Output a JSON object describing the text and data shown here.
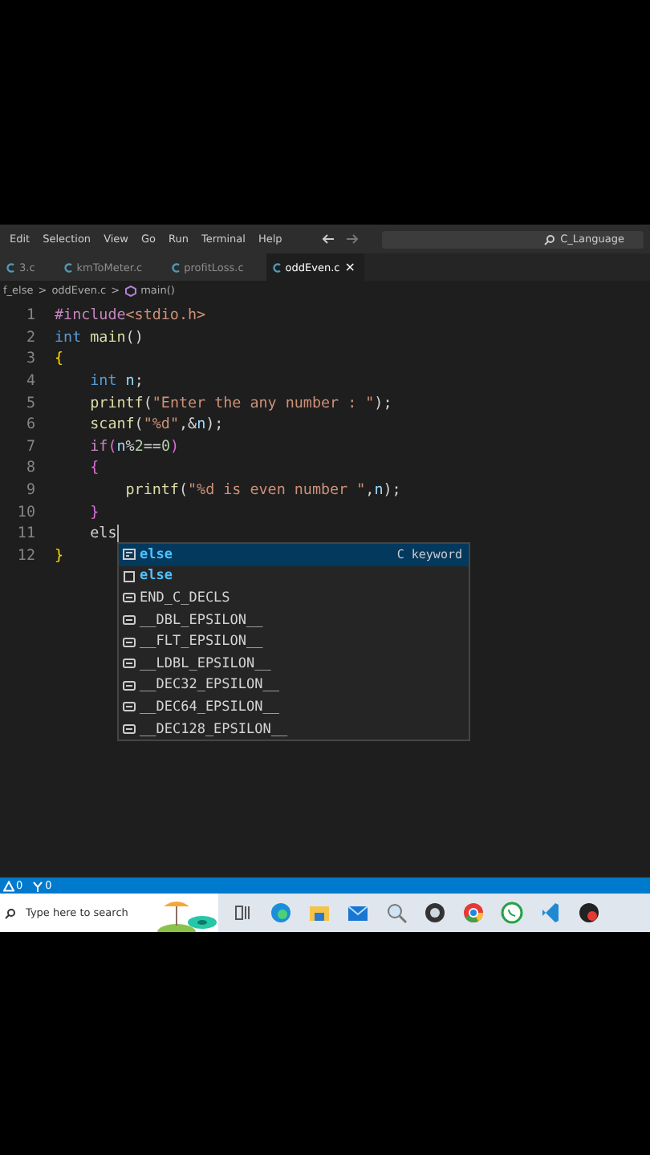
{
  "menu": [
    "Edit",
    "Selection",
    "View",
    "Go",
    "Run",
    "Terminal",
    "Help"
  ],
  "search": {
    "value": "C_Language"
  },
  "tabs": [
    {
      "label": "3.c",
      "selected": false
    },
    {
      "label": "kmToMeter.c",
      "selected": false
    },
    {
      "label": "profitLoss.c",
      "selected": false
    },
    {
      "label": "oddEven.c",
      "selected": true,
      "close": "×"
    }
  ],
  "breadcrumb": [
    "f_else",
    ">",
    "oddEven.c",
    ">",
    "main()"
  ],
  "code": [
    {
      "number": "1",
      "tokens": [
        {
          "text": "#include",
          "kind": "directive"
        },
        {
          "text": "<stdio.h>",
          "kind": "string"
        }
      ]
    },
    {
      "number": "2",
      "tokens": [
        {
          "text": "int",
          "kind": "keyword"
        },
        {
          "text": " main",
          "kind": "function"
        },
        {
          "text": "()",
          "kind": "plain"
        }
      ]
    },
    {
      "number": "3",
      "tokens": [
        {
          "text": "{",
          "kind": "brace"
        }
      ]
    },
    {
      "number": "4",
      "tokens": [
        {
          "text": "    int",
          "kind": "keyword"
        },
        {
          "text": " n",
          "kind": "variable"
        },
        {
          "text": ";",
          "kind": "plain"
        }
      ]
    },
    {
      "number": "5",
      "tokens": [
        {
          "text": "    printf",
          "kind": "function"
        },
        {
          "text": "(",
          "kind": "plain"
        },
        {
          "text": "\"Enter the any number : \"",
          "kind": "string"
        },
        {
          "text": ");",
          "kind": "plain"
        }
      ]
    },
    {
      "number": "6",
      "tokens": [
        {
          "text": "    scanf",
          "kind": "function"
        },
        {
          "text": "(",
          "kind": "plain"
        },
        {
          "text": "\"%d\"",
          "kind": "string"
        },
        {
          "text": ",&",
          "kind": "plain"
        },
        {
          "text": "n",
          "kind": "variable"
        },
        {
          "text": ");",
          "kind": "plain"
        }
      ]
    },
    {
      "number": "7",
      "tokens": [
        {
          "text": "    if",
          "kind": "directive"
        },
        {
          "text": "(",
          "kind": "brace2"
        },
        {
          "text": "n",
          "kind": "variable"
        },
        {
          "text": "%",
          "kind": "plain"
        },
        {
          "text": "2",
          "kind": "number"
        },
        {
          "text": "==",
          "kind": "plain"
        },
        {
          "text": "0",
          "kind": "number"
        },
        {
          "text": ")",
          "kind": "brace2"
        }
      ]
    },
    {
      "number": "8",
      "tokens": [
        {
          "text": "    {",
          "kind": "brace2"
        }
      ]
    },
    {
      "number": "9",
      "tokens": [
        {
          "text": "        printf",
          "kind": "function"
        },
        {
          "text": "(",
          "kind": "plain"
        },
        {
          "text": "\"%d is even number \"",
          "kind": "string"
        },
        {
          "text": ",",
          "kind": "plain"
        },
        {
          "text": "n",
          "kind": "variable"
        },
        {
          "text": ");",
          "kind": "plain"
        }
      ]
    },
    {
      "number": "10",
      "tokens": [
        {
          "text": "    }",
          "kind": "brace2"
        }
      ]
    },
    {
      "number": "11",
      "tokens": [
        {
          "text": "    els",
          "kind": "plain"
        }
      ],
      "cursor": true
    },
    {
      "number": "12",
      "tokens": [
        {
          "text": "}",
          "kind": "brace"
        }
      ]
    }
  ],
  "suggestions": [
    {
      "label": "else",
      "detail": "C keyword",
      "kind": "snippet",
      "selected": true
    },
    {
      "label": "else",
      "kind": "keyword",
      "selected": false
    },
    {
      "label": "END_C_DECLS",
      "kind": "constant",
      "selected": false
    },
    {
      "label": "__DBL_EPSILON__",
      "kind": "constant",
      "selected": false
    },
    {
      "label": "__FLT_EPSILON__",
      "kind": "constant",
      "selected": false
    },
    {
      "label": "__LDBL_EPSILON__",
      "kind": "constant",
      "selected": false
    },
    {
      "label": "__DEC32_EPSILON__",
      "kind": "constant",
      "selected": false
    },
    {
      "label": "__DEC64_EPSILON__",
      "kind": "constant",
      "selected": false
    },
    {
      "label": "__DEC128_EPSILON__",
      "kind": "constant",
      "selected": false
    }
  ],
  "status_bar": {
    "errors": "0",
    "warnings": "0"
  },
  "taskbar": {
    "search_placeholder": "Type here to search"
  }
}
